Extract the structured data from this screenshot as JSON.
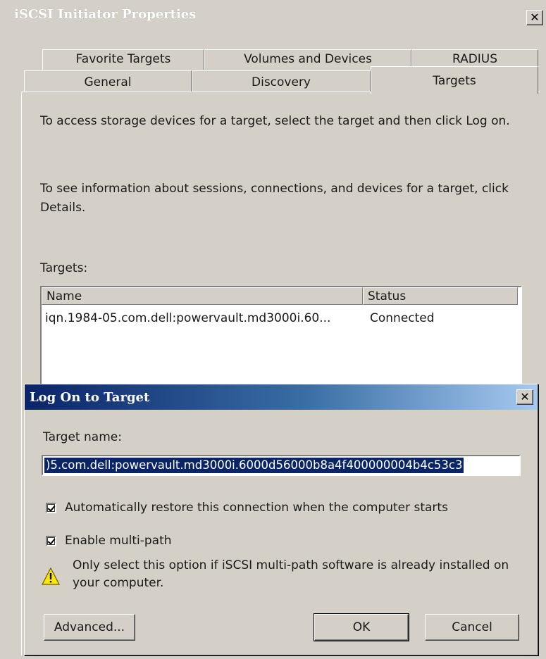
{
  "window": {
    "title": "iSCSI Initiator Properties",
    "close_label": "✕"
  },
  "tabs": {
    "row1": [
      {
        "label": "Favorite Targets"
      },
      {
        "label": "Volumes and Devices"
      },
      {
        "label": "RADIUS"
      }
    ],
    "row2": [
      {
        "label": "General"
      },
      {
        "label": "Discovery"
      },
      {
        "label": "Targets",
        "active": true
      }
    ]
  },
  "targets_panel": {
    "instruction1": "To access storage devices for a target, select the target and then click Log on.",
    "instruction2": "To see information about sessions, connections, and devices for a target, click Details.",
    "targets_label": "Targets:",
    "columns": [
      "Name",
      "Status"
    ],
    "rows": [
      {
        "name": "iqn.1984-05.com.dell:powervault.md3000i.60...",
        "status": "Connected"
      }
    ]
  },
  "logon_dialog": {
    "title": "Log On to Target",
    "close_label": "✕",
    "target_name_label": "Target name:",
    "target_name_value": ")5.com.dell:powervault.md3000i.6000d56000b8a4f400000004b4c53c3",
    "auto_restore": {
      "label": "Automatically restore this connection when the computer starts",
      "checked": true
    },
    "multipath": {
      "label": "Enable multi-path",
      "checked": true
    },
    "warning": {
      "icon": "warning-icon",
      "text": "Only select this option if iSCSI multi-path software is already installed on your computer."
    },
    "buttons": {
      "advanced": "Advanced...",
      "ok": "OK",
      "cancel": "Cancel"
    }
  },
  "colors": {
    "face": "#d4d0c8",
    "title_active": "#0a246a",
    "selection": "#0a246a",
    "warning_fill": "#ffe600"
  }
}
